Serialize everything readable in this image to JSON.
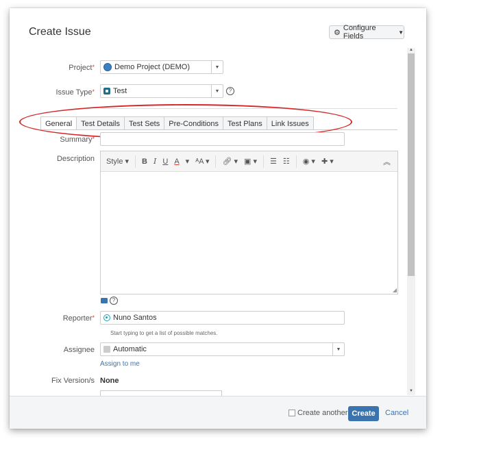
{
  "dialog": {
    "title": "Create Issue",
    "configure_label": "Configure Fields"
  },
  "form": {
    "project": {
      "label": "Project",
      "value": "Demo Project (DEMO)"
    },
    "issue_type": {
      "label": "Issue Type",
      "value": "Test"
    },
    "tabs": [
      {
        "label": "General",
        "active": true
      },
      {
        "label": "Test Details"
      },
      {
        "label": "Test Sets"
      },
      {
        "label": "Pre-Conditions"
      },
      {
        "label": "Test Plans"
      },
      {
        "label": "Link Issues"
      }
    ],
    "summary": {
      "label": "Summary",
      "value": ""
    },
    "description": {
      "label": "Description",
      "toolbar": {
        "style": "Style",
        "bold": "B",
        "italic": "I",
        "underline": "U",
        "color": "A"
      }
    },
    "reporter": {
      "label": "Reporter",
      "value": "Nuno Santos",
      "hint": "Start typing to get a list of possible matches."
    },
    "assignee": {
      "label": "Assignee",
      "value": "Automatic",
      "assign_link": "Assign to me"
    },
    "fix_versions": {
      "label": "Fix Version/s",
      "value": "None"
    }
  },
  "footer": {
    "create_another": "Create another",
    "create": "Create",
    "cancel": "Cancel"
  },
  "colors": {
    "accent": "#3b73af",
    "highlight_oval": "#d62728",
    "required": "#d04437"
  }
}
